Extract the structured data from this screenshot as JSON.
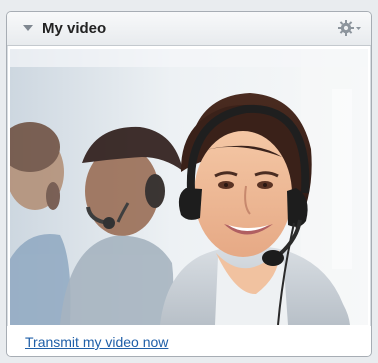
{
  "panel": {
    "title": "My video",
    "collapse_icon": "triangle-down-icon",
    "settings_icon": "gear-icon",
    "menu_indicator_icon": "caret-down-icon"
  },
  "video": {
    "content": "video-preview-image"
  },
  "footer": {
    "transmit_link_label": "Transmit my video now"
  },
  "colors": {
    "link": "#1f5fa8",
    "header_top": "#f8f9fa",
    "header_bottom": "#e8ebee",
    "panel_border": "#a7adb4"
  }
}
